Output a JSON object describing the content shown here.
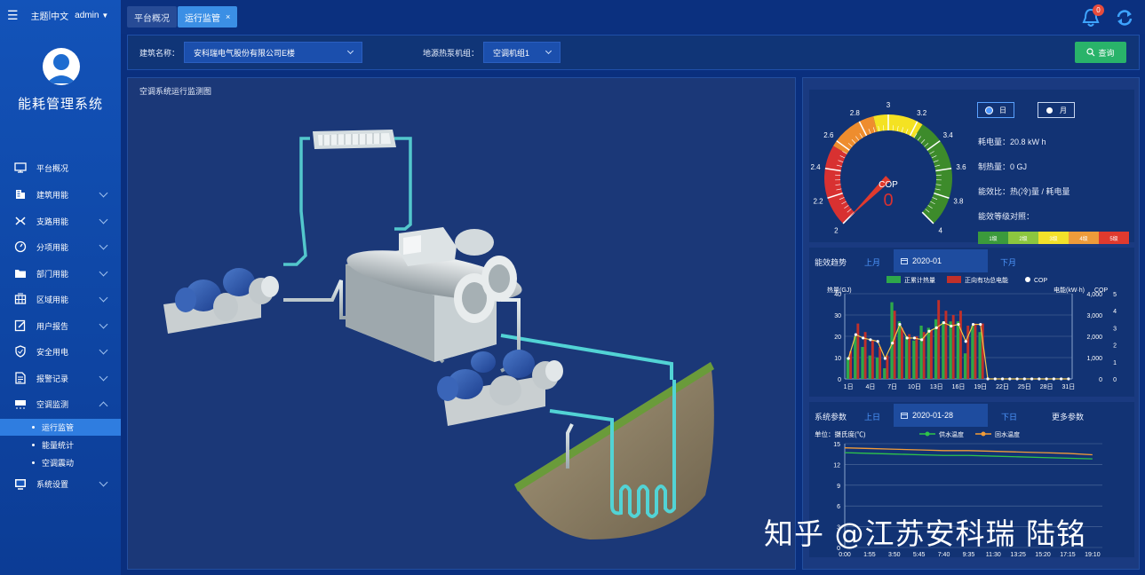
{
  "header": {
    "theme_label": "主题",
    "lang_label": "中文",
    "user": "admin"
  },
  "sidebar": {
    "title": "能耗管理系统",
    "items": [
      {
        "label": "平台概况",
        "icon": "monitor-icon"
      },
      {
        "label": "建筑用能",
        "icon": "building-icon"
      },
      {
        "label": "支路用能",
        "icon": "branch-icon"
      },
      {
        "label": "分项用能",
        "icon": "gauge-icon"
      },
      {
        "label": "部门用能",
        "icon": "folder-icon"
      },
      {
        "label": "区域用能",
        "icon": "grid-icon"
      },
      {
        "label": "用户报告",
        "icon": "edit-icon"
      },
      {
        "label": "安全用电",
        "icon": "shield-icon"
      },
      {
        "label": "报警记录",
        "icon": "document-icon"
      },
      {
        "label": "空调监测",
        "icon": "aircon-icon"
      }
    ],
    "subitems": [
      {
        "label": "运行监管",
        "active": true
      },
      {
        "label": "能量统计",
        "active": false
      },
      {
        "label": "空调震动",
        "active": false
      }
    ],
    "settings": {
      "label": "系统设置",
      "icon": "settings-icon"
    }
  },
  "tabs": [
    {
      "label": "平台概况"
    },
    {
      "label": "运行监管",
      "close": "×"
    }
  ],
  "notifications": {
    "count": "0"
  },
  "filter": {
    "building_label": "建筑名称：",
    "building_value": "安科瑞电气股份有限公司E楼",
    "unit_label": "地源热泵机组：",
    "unit_value": "空调机组1",
    "query_label": "查询"
  },
  "main": {
    "title": "空调系统运行监测图"
  },
  "gauge": {
    "title": "COP",
    "value": 0,
    "min": 2,
    "max": 4,
    "ticks": [
      "2",
      "2.2",
      "2.4",
      "2.6",
      "2.8",
      "3",
      "3.2",
      "3.4",
      "3.6",
      "3.8",
      "4"
    ],
    "display_value": "0",
    "radio": {
      "day": "日",
      "month": "月",
      "selected": "day"
    },
    "stats": {
      "power_label": "耗电量：",
      "power_value": "20.8 kW h",
      "heat_label": "制热量：",
      "heat_value": "0 GJ",
      "ratio_label": "能效比：热(冷)量 / 耗电量",
      "grade_label": "能效等级对照："
    },
    "levels": [
      {
        "label": "1级",
        "color": "#3b9a3c"
      },
      {
        "label": "2级",
        "color": "#8cc63f"
      },
      {
        "label": "3级",
        "color": "#f3e12a"
      },
      {
        "label": "4级",
        "color": "#ee9b3a"
      },
      {
        "label": "5级",
        "color": "#e03a2e"
      }
    ],
    "colors": {
      "red": "#d83131",
      "orange": "#ee8d2e",
      "yellow": "#f4e222",
      "green": "#3d8b2b"
    }
  },
  "trend": {
    "title": "能效趋势",
    "prev": "上月",
    "date": "2020-01",
    "next": "下月",
    "legend": {
      "heat": "正累计热量",
      "power": "正向有功总电能",
      "cop": "COP"
    }
  },
  "params": {
    "title": "系统参数",
    "prev": "上日",
    "date": "2020-01-28",
    "next": "下日",
    "more": "更多参数",
    "unit": "单位：摄氏度(℃)",
    "legend": {
      "supply": "供水温度",
      "return": "回水温度"
    }
  },
  "watermark": "知乎 @江苏安科瑞 陆铭",
  "chart_data": [
    {
      "type": "bar",
      "categories": [
        "1日",
        "2日",
        "3日",
        "4日",
        "5日",
        "6日",
        "7日",
        "8日",
        "9日",
        "10日",
        "11日",
        "12日",
        "13日",
        "14日",
        "15日",
        "16日",
        "17日",
        "18日",
        "19日",
        "20日",
        "21日",
        "22日",
        "23日",
        "24日",
        "25日",
        "26日",
        "27日",
        "28日",
        "29日",
        "30日",
        "31日"
      ],
      "x_ticks": [
        "1日",
        "4日",
        "7日",
        "10日",
        "13日",
        "16日",
        "19日",
        "22日",
        "25日",
        "28日",
        "31日"
      ],
      "ylabel_left": "热量(GJ)",
      "ylabel_right": "电能(kW·h)",
      "ylabel_right2": "COP",
      "ylim": [
        0,
        40
      ],
      "ylim_right": [
        0,
        4000
      ],
      "ylim_right2": [
        0,
        5
      ],
      "y_ticks": [
        "0",
        "10",
        "20",
        "30",
        "40"
      ],
      "y_ticks_right": [
        "0",
        "1,000",
        "2,000",
        "3,000",
        "4,000"
      ],
      "y_ticks_right2": [
        "0",
        "1",
        "2",
        "3",
        "4",
        "5"
      ],
      "series": [
        {
          "name": "正累计热量",
          "color": "#2ea84a",
          "values": [
            10,
            20,
            15,
            11,
            10,
            5,
            36,
            27,
            20,
            18,
            25,
            24,
            28,
            27,
            27,
            27,
            12,
            25,
            22,
            0,
            0,
            0,
            0,
            0,
            0,
            0,
            0,
            0,
            0,
            0,
            0
          ]
        },
        {
          "name": "正向有功总电能",
          "color": "#c0302a",
          "values": [
            1300,
            2600,
            2200,
            1800,
            1500,
            1100,
            3200,
            2400,
            2100,
            2000,
            2200,
            2300,
            3700,
            3200,
            3000,
            3200,
            2500,
            2600,
            2600,
            0,
            0,
            0,
            0,
            0,
            0,
            0,
            0,
            0,
            0,
            0,
            0
          ]
        },
        {
          "name": "COP",
          "color": "#f3c64a",
          "values": [
            1.2,
            2.6,
            2.4,
            2.3,
            2.2,
            1.2,
            2.1,
            3.2,
            2.4,
            2.4,
            2.3,
            2.8,
            3,
            3.3,
            3.1,
            3.2,
            2.2,
            3.2,
            3.2,
            0,
            0,
            0,
            0,
            0,
            0,
            0,
            0,
            0,
            0,
            0,
            0
          ]
        }
      ]
    },
    {
      "type": "line",
      "x_ticks": [
        "0:00",
        "1:55",
        "3:50",
        "5:45",
        "7:40",
        "9:35",
        "11:30",
        "13:25",
        "15:20",
        "17:15",
        "19:10"
      ],
      "ylim": [
        0,
        15
      ],
      "y_ticks": [
        "0",
        "3",
        "6",
        "9",
        "12",
        "15"
      ],
      "series": [
        {
          "name": "供水温度",
          "color": "#2ec44a",
          "values": [
            13.7,
            13.6,
            13.5,
            13.4,
            13.3,
            13.3,
            13.2,
            13.1,
            13,
            12.9,
            12.8
          ]
        },
        {
          "name": "回水温度",
          "color": "#f29c38",
          "values": [
            14.4,
            14.3,
            14.2,
            14.1,
            14,
            14,
            13.9,
            13.8,
            13.7,
            13.6,
            13.4
          ]
        }
      ]
    }
  ]
}
